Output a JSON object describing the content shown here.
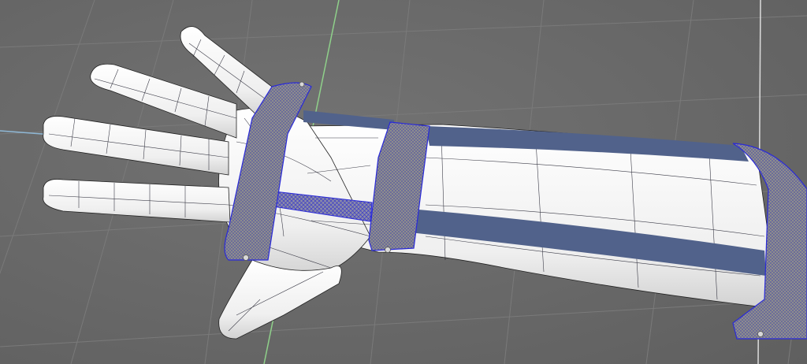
{
  "viewport": {
    "background_color": "#6b6b6b",
    "grid_color": "#7d7d7d",
    "x_axis_color": "#8fb8d6",
    "y_axis_color": "#8fd08a",
    "vertical_guide_color": "#d9d9d9"
  },
  "model": {
    "hand_color": "#f4f4f4",
    "wireframe_color": "#1c1c2a",
    "splint_shell_color": "#51628b",
    "strap_color": "#8a8a8a",
    "strap_mesh_color": "#3a3aa0",
    "selection_color": "#2a2ad8",
    "bar_mesh_color": "#5a5ad0",
    "screw_color": "#d8d8d8"
  }
}
